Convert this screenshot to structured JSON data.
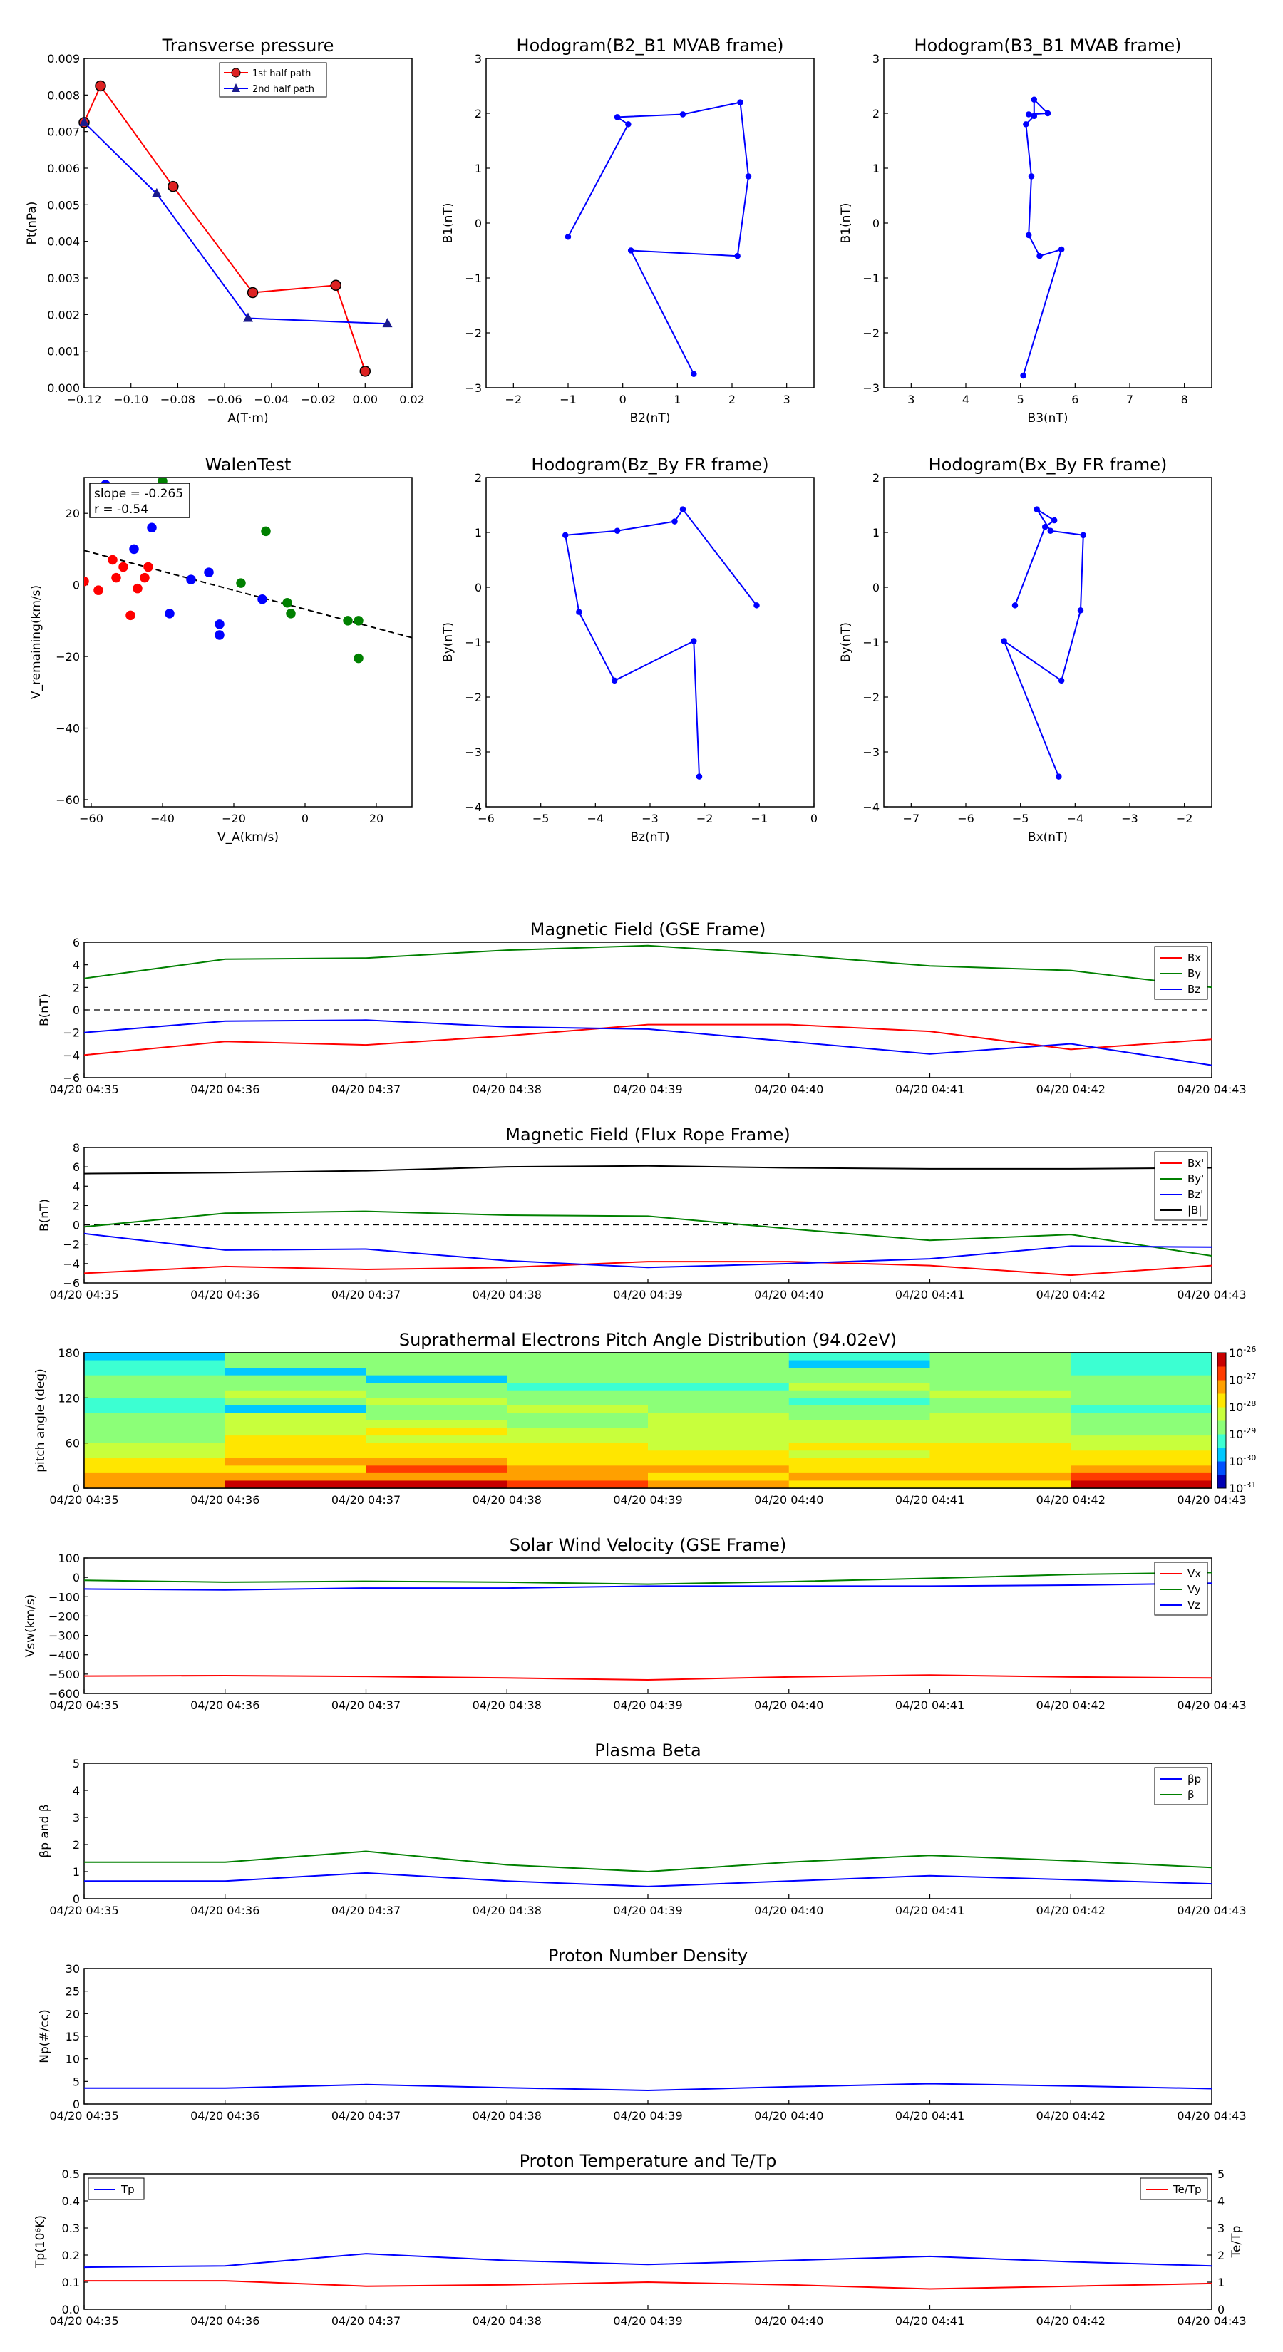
{
  "colors": {
    "red": "#ff0000",
    "green": "#008000",
    "blue": "#0000ff",
    "black": "#000000",
    "marker_red": "#dd2222",
    "marker_navy": "#1a1a8c"
  },
  "time_ticks": [
    "04/20 04:35",
    "04/20 04:36",
    "04/20 04:37",
    "04/20 04:38",
    "04/20 04:39",
    "04/20 04:40",
    "04/20 04:41",
    "04/20 04:42",
    "04/20 04:43"
  ],
  "chart_data": [
    {
      "id": "pt",
      "type": "line",
      "title": "Transverse pressure",
      "xlabel": "A(T·m)",
      "ylabel": "Pt(nPa)",
      "xlim": [
        -0.12,
        0.02
      ],
      "ylim": [
        0,
        0.009
      ],
      "xticks": [
        -0.12,
        -0.1,
        -0.08,
        -0.06,
        -0.04,
        -0.02,
        0.0,
        0.02
      ],
      "yticks": [
        0.0,
        0.001,
        0.002,
        0.003,
        0.004,
        0.005,
        0.006,
        0.007,
        0.008,
        0.009
      ],
      "xtick_labels": [
        "−0.12",
        "−0.10",
        "−0.08",
        "−0.06",
        "−0.04",
        "−0.02",
        "0.00",
        "0.02"
      ],
      "ytick_labels": [
        "0.000",
        "0.001",
        "0.002",
        "0.003",
        "0.004",
        "0.005",
        "0.006",
        "0.007",
        "0.008",
        "0.009"
      ],
      "legend_position": "upper-center",
      "series": [
        {
          "name": "1st half path",
          "color": "red",
          "marker": "circle",
          "x": [
            -0.12,
            -0.113,
            -0.082,
            -0.048,
            -0.0125,
            0.0
          ],
          "y": [
            0.00725,
            0.00825,
            0.0055,
            0.0026,
            0.0028,
            0.00045
          ]
        },
        {
          "name": "2nd half path",
          "color": "blue",
          "marker": "triangle",
          "x": [
            -0.12,
            -0.089,
            -0.05,
            0.0095
          ],
          "y": [
            0.00725,
            0.0053,
            0.0019,
            0.00175
          ]
        }
      ]
    },
    {
      "id": "hodo_b2b1",
      "type": "line",
      "title": "Hodogram(B2_B1 MVAB frame)",
      "xlabel": "B2(nT)",
      "ylabel": "B1(nT)",
      "xlim": [
        -2.5,
        3.5
      ],
      "ylim": [
        -3,
        3
      ],
      "xticks": [
        -2,
        -1,
        0,
        1,
        2,
        3
      ],
      "yticks": [
        -3,
        -2,
        -1,
        0,
        1,
        2,
        3
      ],
      "xtick_labels": [
        "−2",
        "−1",
        "0",
        "1",
        "2",
        "3"
      ],
      "ytick_labels": [
        "−3",
        "−2",
        "−1",
        "0",
        "1",
        "2",
        "3"
      ],
      "series": [
        {
          "color": "blue",
          "marker": "dot",
          "x": [
            1.3,
            0.15,
            2.1,
            2.3,
            2.15,
            1.1,
            -0.1,
            0.1,
            -1.0
          ],
          "y": [
            -2.75,
            -0.5,
            -0.6,
            0.85,
            2.2,
            1.98,
            1.93,
            1.8,
            -0.25
          ]
        }
      ]
    },
    {
      "id": "hodo_b3b1",
      "type": "line",
      "title": "Hodogram(B3_B1 MVAB frame)",
      "xlabel": "B3(nT)",
      "ylabel": "B1(nT)",
      "xlim": [
        2.5,
        8.5
      ],
      "ylim": [
        -3,
        3
      ],
      "xticks": [
        3,
        4,
        5,
        6,
        7,
        8
      ],
      "yticks": [
        -3,
        -2,
        -1,
        0,
        1,
        2,
        3
      ],
      "xtick_labels": [
        "3",
        "4",
        "5",
        "6",
        "7",
        "8"
      ],
      "ytick_labels": [
        "−3",
        "−2",
        "−1",
        "0",
        "1",
        "2",
        "3"
      ],
      "series": [
        {
          "color": "blue",
          "marker": "dot",
          "x": [
            5.05,
            5.75,
            5.35,
            5.15,
            5.2,
            5.1,
            5.25,
            5.25,
            5.5,
            5.15
          ],
          "y": [
            -2.78,
            -0.48,
            -0.6,
            -0.22,
            0.85,
            1.8,
            1.95,
            2.25,
            2.0,
            1.98
          ]
        }
      ]
    },
    {
      "id": "walen",
      "type": "scatter",
      "title": "WalenTest",
      "xlabel": "V_A(km/s)",
      "ylabel": "V_remaining(km/s)",
      "xlim": [
        -62,
        30
      ],
      "ylim": [
        -62,
        30
      ],
      "xticks": [
        -60,
        -40,
        -20,
        0,
        20
      ],
      "yticks": [
        -60,
        -40,
        -20,
        0,
        20
      ],
      "xtick_labels": [
        "−60",
        "−40",
        "−20",
        "0",
        "20"
      ],
      "ytick_labels": [
        "−60",
        "−40",
        "−20",
        "0",
        "20"
      ],
      "annotation": {
        "line1": "slope = -0.265",
        "line2": "r = -0.54"
      },
      "fit": {
        "slope": -0.265,
        "intercept": -6.8
      },
      "series": [
        {
          "color": "red",
          "x": [
            -62,
            -58,
            -54,
            -53,
            -51,
            -49,
            -47,
            -45,
            -44
          ],
          "y": [
            1,
            -1.5,
            7,
            2,
            5,
            -8.5,
            -1,
            2,
            5
          ]
        },
        {
          "color": "blue",
          "x": [
            -56,
            -48,
            -43,
            -38,
            -32,
            -27,
            -24,
            -24,
            -12
          ],
          "y": [
            28,
            10,
            16,
            -8,
            1.5,
            3.5,
            -11,
            -14,
            -4
          ]
        },
        {
          "color": "green",
          "x": [
            -40,
            -18,
            -11,
            -5,
            -4,
            12,
            15,
            15
          ],
          "y": [
            29,
            0.5,
            15,
            -5,
            -8,
            -10,
            -10,
            -20.5
          ]
        }
      ]
    },
    {
      "id": "hodo_bzby",
      "type": "line",
      "title": "Hodogram(Bz_By FR frame)",
      "xlabel": "Bz(nT)",
      "ylabel": "By(nT)",
      "xlim": [
        -6,
        0
      ],
      "ylim": [
        -4,
        2
      ],
      "xticks": [
        -6,
        -5,
        -4,
        -3,
        -2,
        -1,
        0
      ],
      "yticks": [
        -4,
        -3,
        -2,
        -1,
        0,
        1,
        2
      ],
      "xtick_labels": [
        "−6",
        "−5",
        "−4",
        "−3",
        "−2",
        "−1",
        "0"
      ],
      "ytick_labels": [
        "−4",
        "−3",
        "−2",
        "−1",
        "0",
        "1",
        "2"
      ],
      "series": [
        {
          "color": "blue",
          "marker": "dot",
          "x": [
            -2.1,
            -2.2,
            -3.65,
            -4.3,
            -4.55,
            -3.6,
            -2.55,
            -2.4,
            -1.05
          ],
          "y": [
            -3.45,
            -0.98,
            -1.7,
            -0.45,
            0.95,
            1.03,
            1.2,
            1.42,
            -0.33
          ]
        }
      ]
    },
    {
      "id": "hodo_bxby",
      "type": "line",
      "title": "Hodogram(Bx_By FR frame)",
      "xlabel": "Bx(nT)",
      "ylabel": "By(nT)",
      "xlim": [
        -7.5,
        -1.5
      ],
      "ylim": [
        -4,
        2
      ],
      "xticks": [
        -7,
        -6,
        -5,
        -4,
        -3,
        -2
      ],
      "yticks": [
        -4,
        -3,
        -2,
        -1,
        0,
        1,
        2
      ],
      "xtick_labels": [
        "−7",
        "−6",
        "−5",
        "−4",
        "−3",
        "−2"
      ],
      "ytick_labels": [
        "−4",
        "−3",
        "−2",
        "−1",
        "0",
        "1",
        "2"
      ],
      "series": [
        {
          "color": "blue",
          "marker": "dot",
          "x": [
            -4.3,
            -5.3,
            -4.25,
            -3.9,
            -3.85,
            -4.45,
            -4.7,
            -4.38,
            -4.55,
            -5.1
          ],
          "y": [
            -3.45,
            -0.98,
            -1.7,
            -0.42,
            0.95,
            1.03,
            1.42,
            1.22,
            1.1,
            -0.33
          ]
        }
      ]
    },
    {
      "id": "bgse",
      "type": "line",
      "title": "Magnetic Field (GSE Frame)",
      "ylabel": "B(nT)",
      "ylim": [
        -6,
        6
      ],
      "yticks": [
        -6,
        -4,
        -2,
        0,
        2,
        4,
        6
      ],
      "ytick_labels": [
        "−6",
        "−4",
        "−2",
        "0",
        "2",
        "4",
        "6"
      ],
      "zero_line": true,
      "legend_position": "upper-right",
      "series": [
        {
          "name": "Bx",
          "color": "red",
          "values": [
            -4.0,
            -2.8,
            -3.1,
            -2.3,
            -1.3,
            -1.3,
            -1.9,
            -3.5,
            -2.6
          ]
        },
        {
          "name": "By",
          "color": "green",
          "values": [
            2.8,
            4.5,
            4.6,
            5.3,
            5.7,
            4.9,
            3.9,
            3.5,
            2.0
          ]
        },
        {
          "name": "Bz",
          "color": "blue",
          "values": [
            -2.0,
            -1.0,
            -0.9,
            -1.5,
            -1.7,
            -2.8,
            -3.9,
            -3.0,
            -4.9
          ]
        }
      ]
    },
    {
      "id": "bfr",
      "type": "line",
      "title": "Magnetic Field (Flux Rope Frame)",
      "ylabel": "B(nT)",
      "ylim": [
        -6,
        8
      ],
      "yticks": [
        -6,
        -4,
        -2,
        0,
        2,
        4,
        6,
        8
      ],
      "ytick_labels": [
        "−6",
        "−4",
        "−2",
        "0",
        "2",
        "4",
        "6",
        "8"
      ],
      "zero_line": true,
      "legend_position": "upper-right",
      "series": [
        {
          "name": "Bx'",
          "color": "red",
          "values": [
            -5.0,
            -4.3,
            -4.6,
            -4.4,
            -3.8,
            -3.8,
            -4.2,
            -5.2,
            -4.2
          ]
        },
        {
          "name": "By'",
          "color": "green",
          "values": [
            -0.2,
            1.2,
            1.4,
            1.0,
            0.9,
            -0.4,
            -1.6,
            -1.0,
            -3.2
          ]
        },
        {
          "name": "Bz'",
          "color": "blue",
          "values": [
            -0.9,
            -2.6,
            -2.5,
            -3.7,
            -4.4,
            -4.0,
            -3.5,
            -2.2,
            -2.3
          ]
        },
        {
          "name": "|B|",
          "color": "black",
          "values": [
            5.3,
            5.4,
            5.6,
            6.0,
            6.1,
            5.9,
            5.8,
            5.8,
            5.9
          ]
        }
      ]
    },
    {
      "id": "pad",
      "type": "heatmap",
      "title": "Suprathermal Electrons Pitch Angle Distribution (94.02eV)",
      "ylabel": "pitch angle (deg)",
      "ylim": [
        0,
        180
      ],
      "yticks": [
        0,
        60,
        120,
        180
      ],
      "ytick_labels": [
        "0",
        "60",
        "120",
        "180"
      ],
      "colorbar_ticks": [
        "-26",
        "-27",
        "-28",
        "-29",
        "-30",
        "-31"
      ],
      "colorbar_base": "10",
      "colorbar_range": [
        -31,
        -26
      ]
    },
    {
      "id": "vsw",
      "type": "line",
      "title": "Solar Wind Velocity (GSE Frame)",
      "ylabel": "Vsw(km/s)",
      "ylim": [
        -600,
        100
      ],
      "yticks": [
        -600,
        -500,
        -400,
        -300,
        -200,
        -100,
        0,
        100
      ],
      "ytick_labels": [
        "−600",
        "−500",
        "−400",
        "−300",
        "−200",
        "−100",
        "0",
        "100"
      ],
      "legend_position": "upper-right",
      "series": [
        {
          "name": "Vx",
          "color": "red",
          "values": [
            -510,
            -508,
            -512,
            -520,
            -530,
            -515,
            -505,
            -515,
            -520
          ]
        },
        {
          "name": "Vy",
          "color": "green",
          "values": [
            -15,
            -25,
            -20,
            -25,
            -35,
            -22,
            -5,
            15,
            25
          ]
        },
        {
          "name": "Vz",
          "color": "blue",
          "values": [
            -60,
            -65,
            -55,
            -55,
            -45,
            -45,
            -45,
            -40,
            -30
          ]
        }
      ]
    },
    {
      "id": "beta",
      "type": "line",
      "title": "Plasma Beta",
      "ylabel": "βp and β",
      "ylim": [
        0,
        5
      ],
      "yticks": [
        0,
        1,
        2,
        3,
        4,
        5
      ],
      "ytick_labels": [
        "0",
        "1",
        "2",
        "3",
        "4",
        "5"
      ],
      "legend_position": "upper-right",
      "series": [
        {
          "name": "βp",
          "color": "blue",
          "values": [
            0.65,
            0.65,
            0.95,
            0.65,
            0.45,
            0.65,
            0.85,
            0.7,
            0.55
          ]
        },
        {
          "name": "β",
          "color": "green",
          "values": [
            1.35,
            1.35,
            1.75,
            1.25,
            1.0,
            1.35,
            1.6,
            1.4,
            1.15
          ]
        }
      ]
    },
    {
      "id": "np",
      "type": "line",
      "title": "Proton Number Density",
      "ylabel": "Np(#/cc)",
      "ylim": [
        0,
        30
      ],
      "yticks": [
        0,
        5,
        10,
        15,
        20,
        25,
        30
      ],
      "ytick_labels": [
        "0",
        "5",
        "10",
        "15",
        "20",
        "25",
        "30"
      ],
      "series": [
        {
          "color": "blue",
          "values": [
            3.5,
            3.5,
            4.3,
            3.6,
            3.0,
            3.8,
            4.5,
            4.0,
            3.4
          ]
        }
      ]
    },
    {
      "id": "tp",
      "type": "line",
      "title": "Proton Temperature and Te/Tp",
      "ylabel": "Tp(10⁶K)",
      "ylabel_right": "Te/Tp",
      "ylim": [
        0,
        0.5
      ],
      "yticks": [
        0,
        0.1,
        0.2,
        0.3,
        0.4,
        0.5
      ],
      "ytick_labels": [
        "0.0",
        "0.1",
        "0.2",
        "0.3",
        "0.4",
        "0.5"
      ],
      "ylim_right": [
        0,
        5
      ],
      "yticks_right": [
        0,
        1,
        2,
        3,
        4,
        5
      ],
      "ytick_labels_right": [
        "0",
        "1",
        "2",
        "3",
        "4",
        "5"
      ],
      "legend_left": "upper-left",
      "legend_right": "upper-right",
      "series": [
        {
          "name": "Tp",
          "color": "blue",
          "axis": "left",
          "values": [
            0.155,
            0.16,
            0.205,
            0.18,
            0.165,
            0.18,
            0.195,
            0.175,
            0.16
          ]
        },
        {
          "name": "Te/Tp",
          "color": "red",
          "axis": "right",
          "values": [
            1.05,
            1.05,
            0.85,
            0.9,
            1.0,
            0.9,
            0.75,
            0.85,
            0.95
          ]
        }
      ]
    }
  ]
}
